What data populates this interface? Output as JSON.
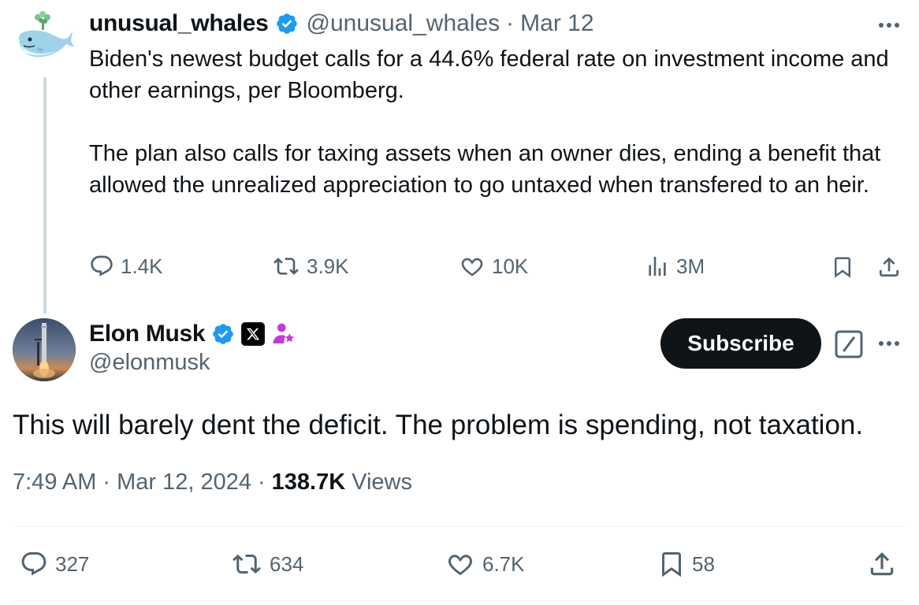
{
  "parent_tweet": {
    "display_name": "unusual_whales",
    "handle": "@unusual_whales",
    "separator": "·",
    "date": "Mar 12",
    "body_paragraphs": [
      "Biden's newest budget calls for a 44.6% federal rate on investment income and other earnings, per Bloomberg.",
      "The plan also calls for taxing assets when an owner dies, ending a benefit that allowed the unrealized appreciation to go untaxed when transfered to an heir."
    ],
    "actions": {
      "replies": "1.4K",
      "reposts": "3.9K",
      "likes": "10K",
      "views": "3M"
    },
    "icons": [
      "whale-avatar-icon",
      "verified-badge-icon",
      "more-icon",
      "reply-icon",
      "repost-icon",
      "like-icon",
      "views-icon",
      "bookmark-icon",
      "share-icon"
    ]
  },
  "main_tweet": {
    "display_name": "Elon Musk",
    "handle": "@elonmusk",
    "subscribe_label": "Subscribe",
    "text": "This will barely dent the deficit. The problem is spending, not taxation.",
    "time": "7:49 AM",
    "separator": "·",
    "date": "Mar 12, 2024",
    "views_count": "138.7K",
    "views_label": "Views",
    "actions": {
      "replies": "327",
      "reposts": "634",
      "likes": "6.7K",
      "bookmarks": "58"
    },
    "icons": [
      "avatar",
      "verified-badge-icon",
      "x-badge-icon",
      "affiliate-badge-icon",
      "grok-icon",
      "more-icon",
      "reply-icon",
      "repost-icon",
      "like-icon",
      "bookmark-icon",
      "share-icon"
    ]
  },
  "colors": {
    "text": "#0f1419",
    "secondary": "#536471",
    "verified": "#1d9bf0",
    "thread_line": "#cfd9de",
    "button_bg": "#0f1419",
    "affiliate": "#c13cd9"
  }
}
